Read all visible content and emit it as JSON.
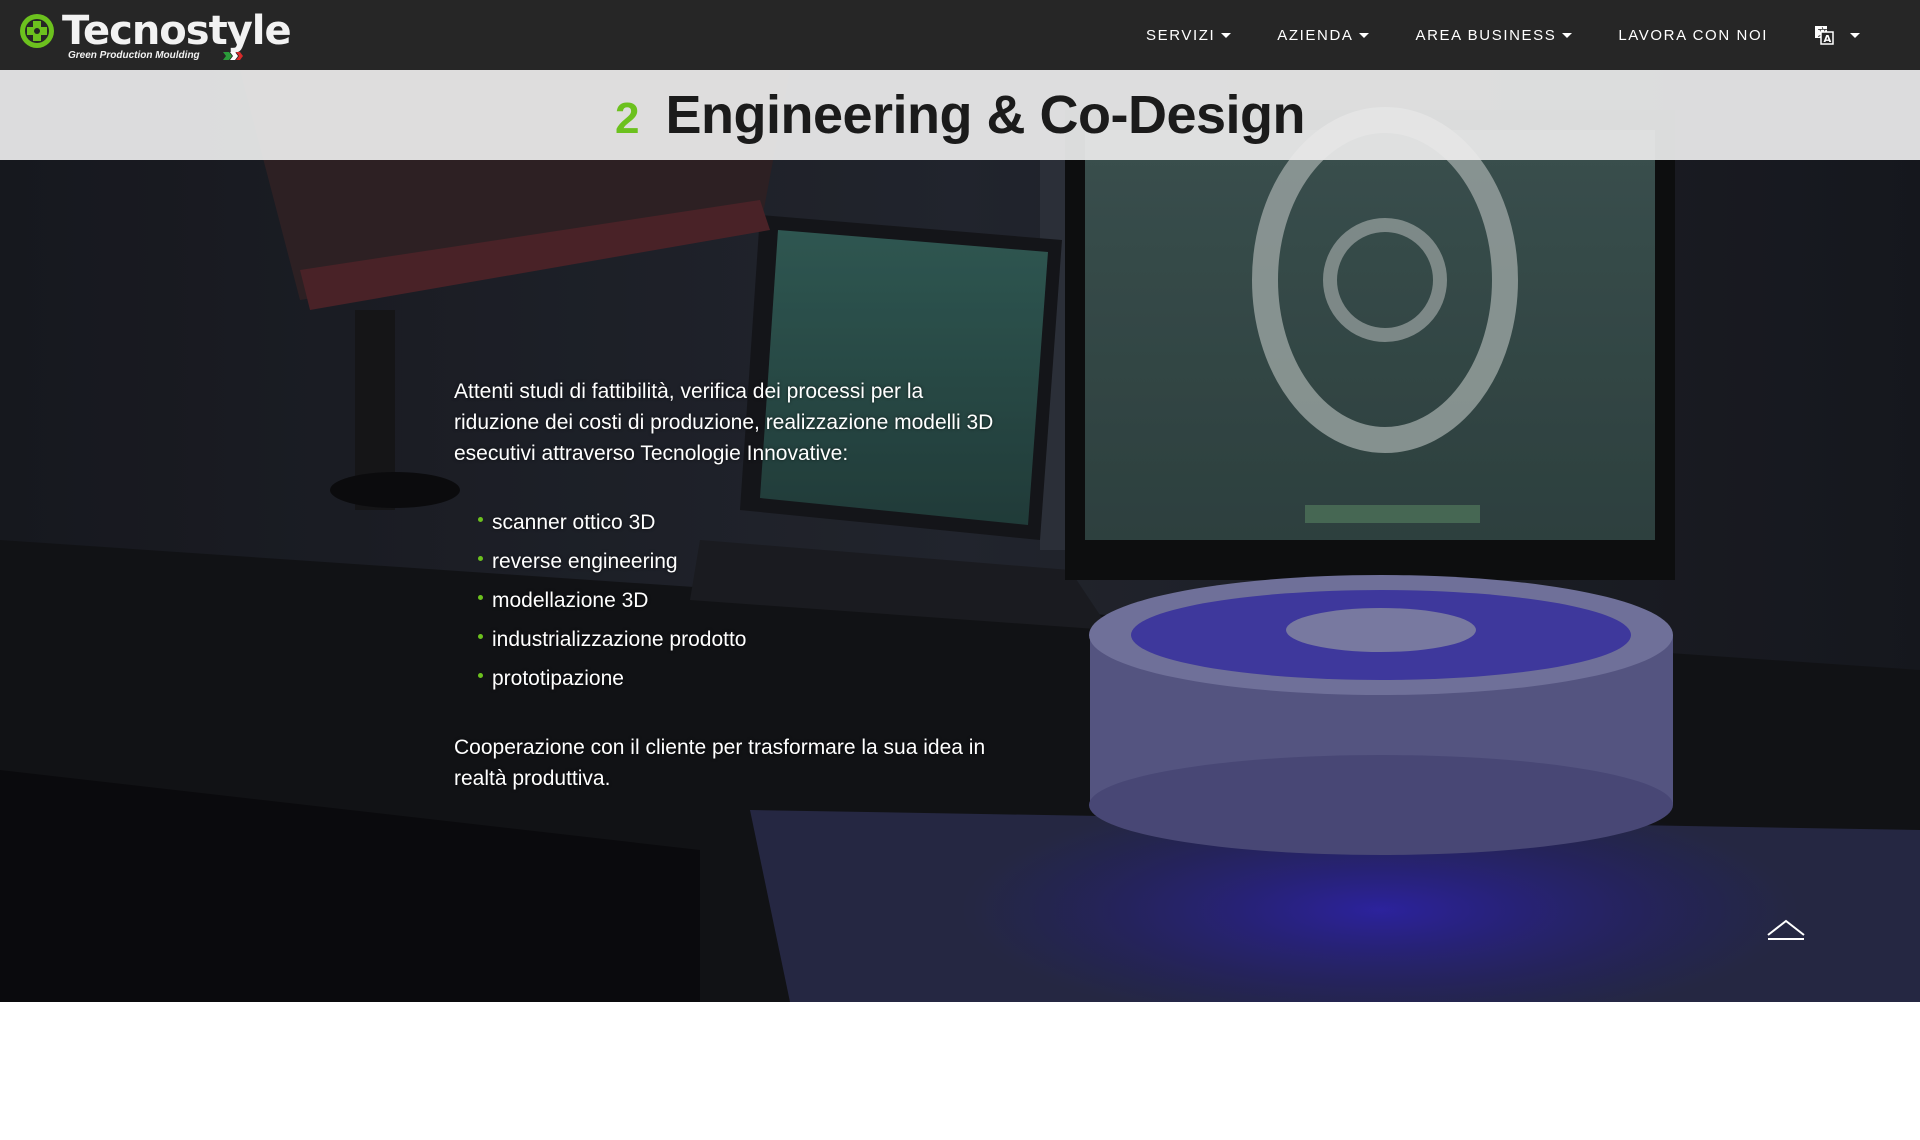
{
  "brand": {
    "name": "Tecnostyle",
    "tagline": "Green Production Moulding",
    "accent_color": "#6cc11e"
  },
  "nav": {
    "items": [
      {
        "label": "SERVIZI",
        "has_caret": true
      },
      {
        "label": "AZIENDA",
        "has_caret": true
      },
      {
        "label": "AREA BUSINESS",
        "has_caret": true
      },
      {
        "label": "LAVORA CON NOI",
        "has_caret": false
      }
    ],
    "language_icon": "translate-icon"
  },
  "section": {
    "number": "2",
    "title": "Engineering & Co-Design",
    "intro": "Attenti studi di fattibilità, verifica dei processi per la riduzione dei costi di produzione, realizzazione modelli 3D esecutivi attraverso Tecnologie Innovative:",
    "features": [
      "scanner ottico 3D",
      "reverse engineering",
      "modellazione 3D",
      "industrializzazione prodotto",
      "prototipazione"
    ],
    "outro": "Cooperazione con il cliente per trasformare la sua idea in realtà produttiva."
  },
  "scroll_top_icon": "chevron-up-icon"
}
